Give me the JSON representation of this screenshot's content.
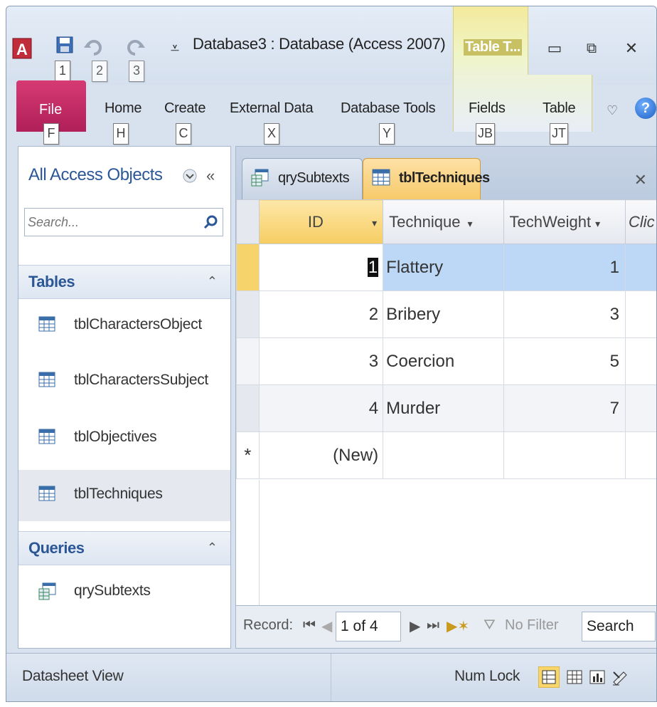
{
  "window": {
    "title": "Database3 : Database (Access 2007)",
    "context_tab": "Table T..."
  },
  "qat_keytips": [
    "1",
    "2",
    "3"
  ],
  "ribbon": {
    "file": "File",
    "tabs": [
      {
        "label": "Home",
        "keytip": "H"
      },
      {
        "label": "Create",
        "keytip": "C"
      },
      {
        "label": "External Data",
        "keytip": "X"
      },
      {
        "label": "Database Tools",
        "keytip": "Y"
      },
      {
        "label": "Fields",
        "keytip": "JB"
      },
      {
        "label": "Table",
        "keytip": "JT"
      }
    ],
    "file_keytip": "F"
  },
  "nav": {
    "title": "All Access Objects",
    "search_placeholder": "Search...",
    "groups": [
      {
        "name": "Tables",
        "items": [
          "tblCharactersObject",
          "tblCharactersSubject",
          "tblObjectives",
          "tblTechniques"
        ]
      },
      {
        "name": "Queries",
        "items": [
          "qrySubtexts"
        ]
      }
    ]
  },
  "doc_tabs": [
    {
      "label": "qrySubtexts",
      "active": false
    },
    {
      "label": "tblTechniques",
      "active": true
    }
  ],
  "grid": {
    "columns": [
      "ID",
      "Technique",
      "TechWeight",
      "Clic"
    ],
    "rows": [
      {
        "id": "1",
        "technique": "Flattery",
        "weight": "1"
      },
      {
        "id": "2",
        "technique": "Bribery",
        "weight": "3"
      },
      {
        "id": "3",
        "technique": "Coercion",
        "weight": "5"
      },
      {
        "id": "4",
        "technique": "Murder",
        "weight": "7"
      }
    ],
    "new_row": "(New)",
    "new_marker": "*"
  },
  "record_nav": {
    "label": "Record:",
    "position": "1 of 4",
    "filter": "No Filter",
    "search": "Search"
  },
  "status": {
    "view": "Datasheet View",
    "num_lock": "Num Lock"
  },
  "colors": {
    "file_tab": "#c0245f",
    "accent": "#2b5797",
    "selected_row": "#bcd8f6"
  }
}
